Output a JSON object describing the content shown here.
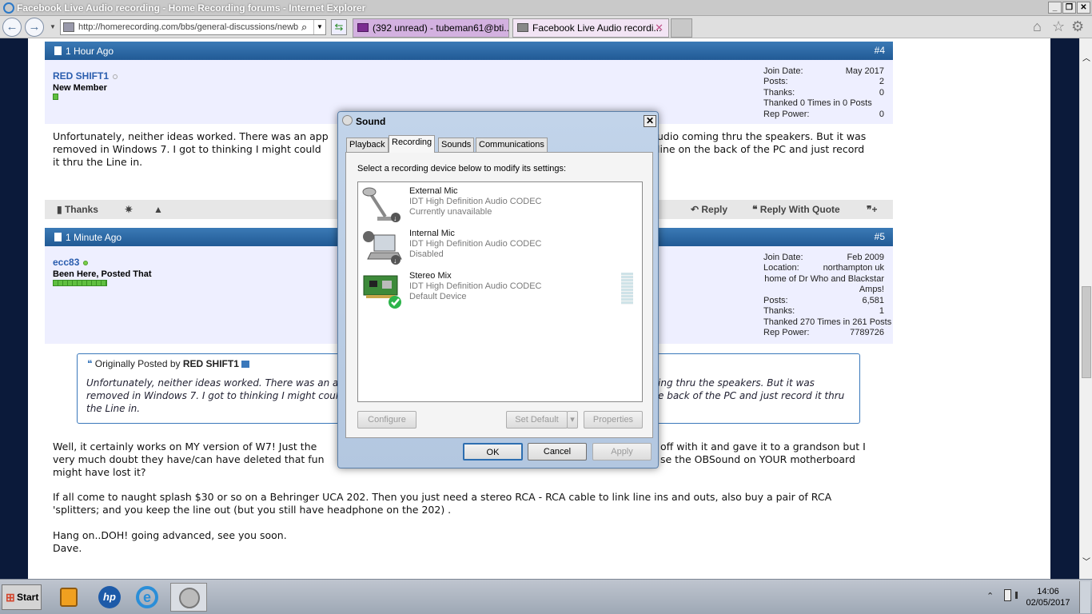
{
  "window": {
    "title": "Facebook Live Audio recording - Home Recording forums - Internet Explorer"
  },
  "nav": {
    "url": "http://homerecording.com/bbs/general-discussions/newb",
    "tabs": [
      {
        "label": "(392 unread) - tubeman61@bti..."
      },
      {
        "label": "Facebook Live Audio recordi..."
      }
    ]
  },
  "post4": {
    "time": "1 Hour Ago",
    "number": "#4",
    "username": "RED SHIFT1",
    "user_title": "New Member",
    "stats": {
      "join_label": "Join Date:",
      "join_value": "May 2017",
      "posts_label": "Posts:",
      "posts_value": "2",
      "thanks_label": "Thanks:",
      "thanks_value": "0",
      "thanked": "Thanked 0 Times in 0 Posts",
      "rep_label": "Rep Power:",
      "rep_value": "0"
    },
    "line1a": "Unfortunately, neither ideas worked. There was an app",
    "line1b": "udio coming thru the speakers. But it was",
    "line2a": "removed in Windows 7. I got to thinking I might could",
    "line2b": "line on the back of the PC and just record",
    "line3": "it thru the Line in.",
    "actions": {
      "thanks": "Thanks",
      "reply": "Reply",
      "reply_quote": "Reply With Quote"
    }
  },
  "post5": {
    "time": "1 Minute Ago",
    "number": "#5",
    "username": "ecc83",
    "user_title": "Been Here, Posted That",
    "stats": {
      "join_label": "Join Date:",
      "join_value": "Feb 2009",
      "location_label": "Location:",
      "location_value": "northampton uk",
      "location_line2": "home of Dr Who and Blackstar",
      "location_line3": "Amps!",
      "posts_label": "Posts:",
      "posts_value": "6,581",
      "thanks_label": "Thanks:",
      "thanks_value": "1",
      "thanked": "Thanked 270 Times in 261 Posts",
      "rep_label": "Rep Power:",
      "rep_value": "7789726"
    },
    "quote": {
      "prefix": "Originally Posted by",
      "author": "RED SHIFT1",
      "l1a": "Unfortunately, neither ideas worked. There was an app",
      "l1b": "ing thru the speakers. But it was",
      "l2a": "removed in Windows 7. I got to thinking I might could",
      "l2b": "e back of the PC and just record it thru",
      "l3": "the Line in."
    },
    "p1a": "Well, it certainly works on MY version of W7! Just the",
    "p1b": "off with it and gave it to a grandson but I",
    "p2a": "very much doubt they have/can have deleted that fun",
    "p2b": "se the OBSound on YOUR motherboard",
    "p3": "might have lost it?",
    "p4": "If all come to naught splash $30 or so on a Behringer UCA 202. Then you just need a stereo RCA - RCA cable to link line ins and outs, also buy a pair of RCA",
    "p5": "'splitters; and you keep the line out (but you still have headphone on the 202) .",
    "p6": "Hang on..DOH! going advanced, see you soon.",
    "p7": "Dave."
  },
  "dialog": {
    "title": "Sound",
    "tabs": [
      "Playback",
      "Recording",
      "Sounds",
      "Communications"
    ],
    "instruction": "Select a recording device below to modify its settings:",
    "devices": [
      {
        "name": "External Mic",
        "driver": "IDT High Definition Audio CODEC",
        "status": "Currently unavailable"
      },
      {
        "name": "Internal Mic",
        "driver": "IDT High Definition Audio CODEC",
        "status": "Disabled"
      },
      {
        "name": "Stereo Mix",
        "driver": "IDT High Definition Audio CODEC",
        "status": "Default Device"
      }
    ],
    "buttons": {
      "configure": "Configure",
      "set_default": "Set Default",
      "properties": "Properties",
      "ok": "OK",
      "cancel": "Cancel",
      "apply": "Apply"
    }
  },
  "taskbar": {
    "start": "Start",
    "time": "14:06",
    "date": "02/05/2017"
  }
}
